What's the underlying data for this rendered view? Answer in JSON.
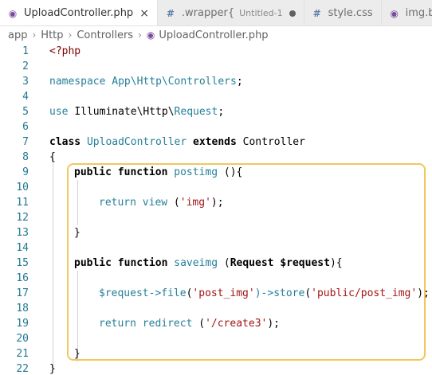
{
  "tabs": [
    {
      "icon": "php-elephant-icon",
      "label": "UploadController.php",
      "active": true,
      "close": "×"
    },
    {
      "icon": "css-hash-icon",
      "label": ".wrapper{",
      "sublabel": "Untitled-1",
      "modified": true
    },
    {
      "icon": "css-hash-icon",
      "label": "style.css"
    },
    {
      "icon": "php-elephant-icon",
      "label": "img.bla"
    }
  ],
  "breadcrumb": [
    "app",
    "Http",
    "Controllers",
    "UploadController.php"
  ],
  "code": {
    "line_numbers": [
      "1",
      "2",
      "3",
      "4",
      "5",
      "6",
      "7",
      "8",
      "9",
      "10",
      "11",
      "12",
      "13",
      "14",
      "15",
      "16",
      "17",
      "18",
      "19",
      "20",
      "21",
      "22"
    ],
    "l1": "<?php",
    "l3_kw": "namespace",
    "l3_ns": "App\\Http\\Controllers",
    "l3_end": ";",
    "l5_kw": "use",
    "l5_a": "Illuminate\\Http\\",
    "l5_b": "Request",
    "l5_end": ";",
    "l7_class": "class",
    "l7_name": "UploadController",
    "l7_extends": "extends",
    "l7_parent": "Controller",
    "l8": "{",
    "l9_public": "public",
    "l9_function": "function",
    "l9_name": "postimg",
    "l9_rest": " (){",
    "l11_return": "return",
    "l11_fn": "view",
    "l11_open": " (",
    "l11_str": "'img'",
    "l11_close": ");",
    "l13": "}",
    "l15_public": "public",
    "l15_function": "function",
    "l15_name": "saveimg",
    "l15_open": " (",
    "l15_type": "Request",
    "l15_var": "$request",
    "l15_close": "){",
    "l17_var": "$request",
    "l17_arrow1": "->",
    "l17_file": "file",
    "l17_p1": "(",
    "l17_str1": "'post_img'",
    "l17_p2": ")->",
    "l17_store": "store",
    "l17_p3": "(",
    "l17_str2": "'public/post_img'",
    "l17_p4": ");",
    "l19_return": "return",
    "l19_fn": "redirect",
    "l19_open": " (",
    "l19_str": "'/create3'",
    "l19_close": ");",
    "l21": "}",
    "l22": "}"
  },
  "colors": {
    "highlight_border": "#f2c75c",
    "line_number": "#237893",
    "keyword": "#000000",
    "type": "#267f99",
    "function": "#795e26",
    "string": "#a31515",
    "variable": "#001080"
  }
}
